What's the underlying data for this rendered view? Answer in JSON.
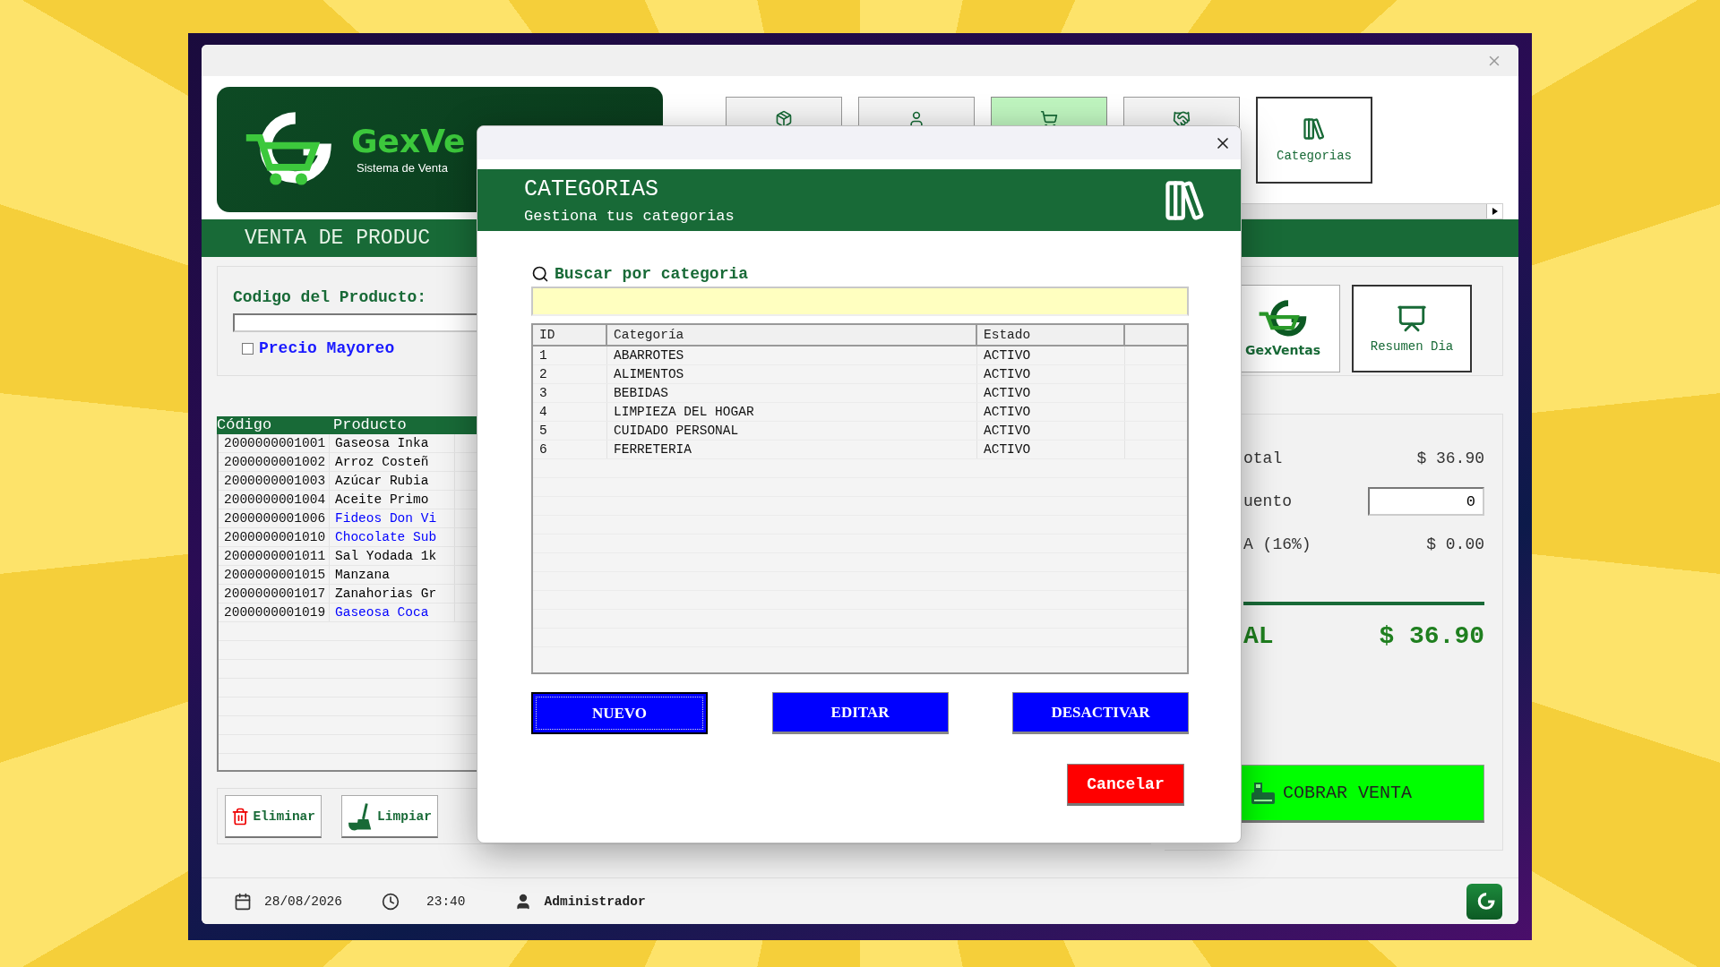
{
  "logo": {
    "name": "GexVe",
    "tagline": "Sistema de Venta"
  },
  "toolbar": [
    {
      "kind": "box",
      "selected": false
    },
    {
      "kind": "person",
      "selected": false
    },
    {
      "kind": "cart",
      "selected": true
    },
    {
      "kind": "handshake",
      "selected": false
    },
    {
      "kind": "categories",
      "label": "Categorias",
      "selected": false
    }
  ],
  "section_title": "VENTA DE PRODUC",
  "product_search": {
    "label": "Codigo del Producto:",
    "wholesale": {
      "label": "Precio Mayoreo",
      "checked": false
    }
  },
  "products": {
    "columns": [
      "Código",
      "Producto"
    ],
    "rows": [
      {
        "code": "2000000001001",
        "name": "Gaseosa Inka",
        "color": "#000000"
      },
      {
        "code": "2000000001002",
        "name": "Arroz Costeñ",
        "color": "#000000"
      },
      {
        "code": "2000000001003",
        "name": "Azúcar Rubia",
        "color": "#000000"
      },
      {
        "code": "2000000001004",
        "name": "Aceite Primo",
        "color": "#000000"
      },
      {
        "code": "2000000001006",
        "name": "Fideos Don Vi",
        "color": "#0000ff"
      },
      {
        "code": "2000000001010",
        "name": "Chocolate Sub",
        "color": "#0000ff"
      },
      {
        "code": "2000000001011",
        "name": "Sal Yodada 1k",
        "color": "#000000"
      },
      {
        "code": "2000000001015",
        "name": "Manzana",
        "color": "#000000"
      },
      {
        "code": "2000000001017",
        "name": "Zanahorias Gr",
        "color": "#000000"
      },
      {
        "code": "2000000001019",
        "name": "Gaseosa Coca",
        "color": "#0000ff"
      }
    ]
  },
  "actions": [
    {
      "kind": "trash",
      "label": "Eliminar"
    },
    {
      "kind": "broom",
      "label": "Limpiar"
    }
  ],
  "side_buttons": [
    {
      "kind": "logo",
      "label": "GexVentas"
    },
    {
      "kind": "report",
      "label": "Resumen Dia"
    }
  ],
  "totals": {
    "subtotal_label": "otal",
    "subtotal": "$ 36.90",
    "discount_label": "uento",
    "discount": "0",
    "tax_label": "A (16%)",
    "tax": "$ 0.00",
    "total_label": "AL",
    "total": "$ 36.90"
  },
  "charge_button": "COBRAR VENTA",
  "status_bar": {
    "date": "28/08/2026",
    "time": "23:40",
    "user": "Administrador"
  },
  "dialog": {
    "title": "CATEGORIAS",
    "subtitle": "Gestiona tus categorias",
    "search_label": "Buscar por categoria",
    "table": {
      "columns": [
        "ID",
        "Categoría",
        "Estado"
      ],
      "rows": [
        {
          "id": "1",
          "category": "ABARROTES",
          "status": "ACTIVO"
        },
        {
          "id": "2",
          "category": "ALIMENTOS",
          "status": "ACTIVO"
        },
        {
          "id": "3",
          "category": "BEBIDAS",
          "status": "ACTIVO"
        },
        {
          "id": "4",
          "category": "LIMPIEZA DEL HOGAR",
          "status": "ACTIVO"
        },
        {
          "id": "5",
          "category": "CUIDADO PERSONAL",
          "status": "ACTIVO"
        },
        {
          "id": "6",
          "category": "FERRETERIA",
          "status": "ACTIVO"
        }
      ]
    },
    "buttons": [
      {
        "label": "NUEVO",
        "focused": true
      },
      {
        "label": "EDITAR",
        "focused": false
      },
      {
        "label": "DESACTIVAR",
        "focused": false
      }
    ],
    "cancel": "Cancelar"
  }
}
